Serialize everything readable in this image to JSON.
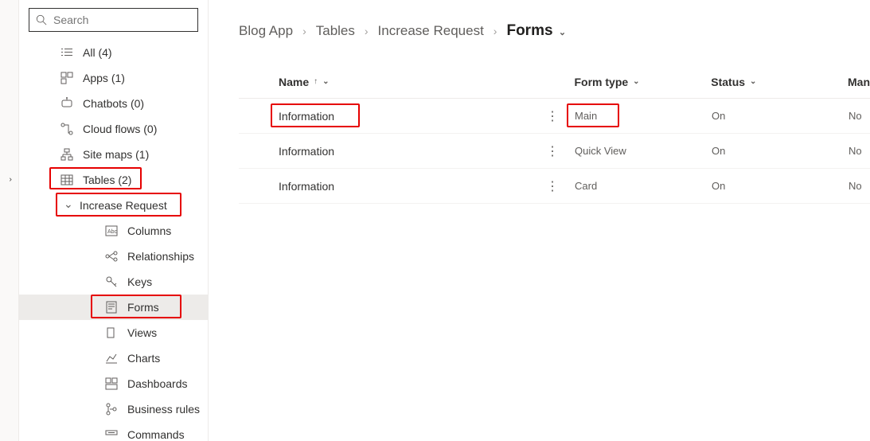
{
  "search": {
    "placeholder": "Search"
  },
  "sidebar": {
    "all": {
      "label": "All",
      "count": "(4)"
    },
    "apps": {
      "label": "Apps",
      "count": "(1)"
    },
    "chatbots": {
      "label": "Chatbots",
      "count": "(0)"
    },
    "cloudflows": {
      "label": "Cloud flows",
      "count": "(0)"
    },
    "sitemaps": {
      "label": "Site maps",
      "count": "(1)"
    },
    "tables": {
      "label": "Tables",
      "count": "(2)"
    },
    "increase": {
      "label": "Increase Request"
    },
    "sub": {
      "columns": "Columns",
      "relationships": "Relationships",
      "keys": "Keys",
      "forms": "Forms",
      "views": "Views",
      "charts": "Charts",
      "dashboards": "Dashboards",
      "businessrules": "Business rules",
      "commands": "Commands"
    }
  },
  "breadcrumb": {
    "app": "Blog App",
    "tables": "Tables",
    "entity": "Increase Request",
    "forms": "Forms"
  },
  "columns": {
    "name": "Name",
    "type": "Form type",
    "status": "Status",
    "man": "Man"
  },
  "rows": [
    {
      "name": "Information",
      "type": "Main",
      "status": "On",
      "man": "No"
    },
    {
      "name": "Information",
      "type": "Quick View",
      "status": "On",
      "man": "No"
    },
    {
      "name": "Information",
      "type": "Card",
      "status": "On",
      "man": "No"
    }
  ]
}
